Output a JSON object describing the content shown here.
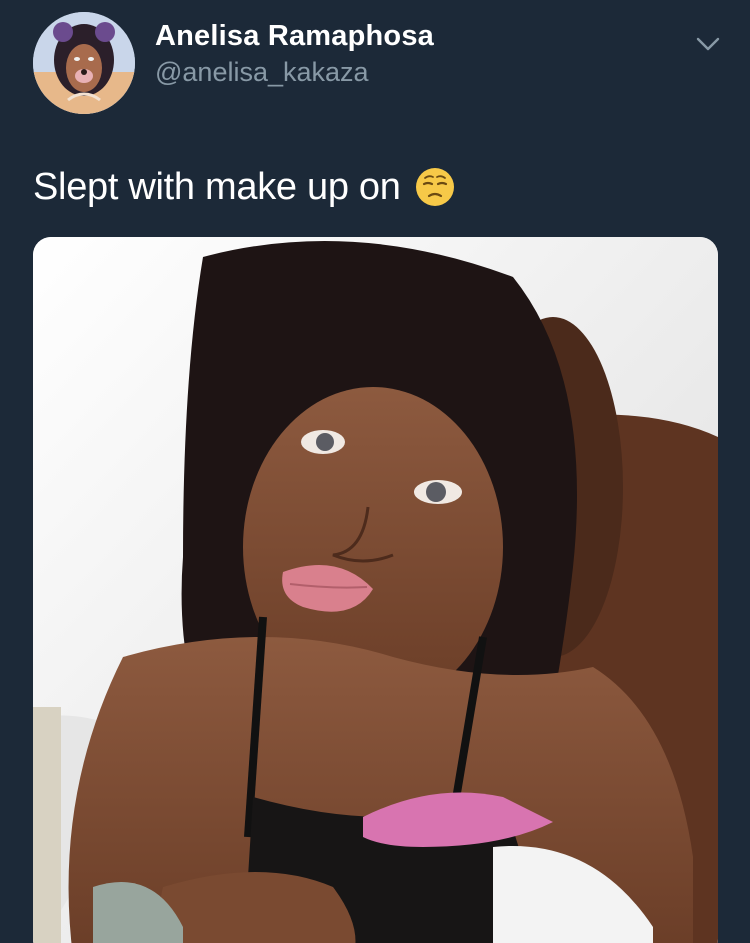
{
  "user": {
    "display_name": "Anelisa Ramaphosa",
    "handle": "@anelisa_kakaza"
  },
  "tweet": {
    "text": "Slept with make up on",
    "emoji": "pensive-face-emoji"
  },
  "icons": {
    "menu": "chevron-down-icon"
  },
  "colors": {
    "background": "#1c2938",
    "primary_text": "#ffffff",
    "secondary_text": "#8899a6"
  }
}
